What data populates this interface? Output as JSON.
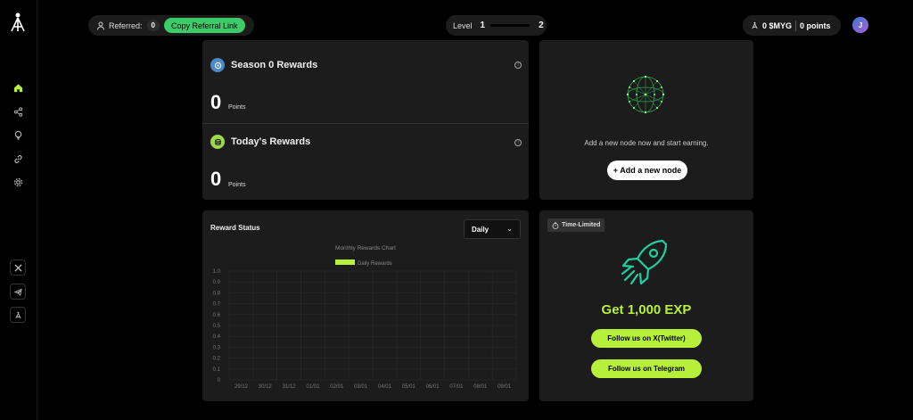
{
  "referral": {
    "label": "Referred:",
    "count": "0",
    "button": "Copy Referral Link"
  },
  "level": {
    "label": "Level",
    "current": "1",
    "next": "2",
    "progress": 0
  },
  "balance": {
    "myg": "0 $MYG",
    "points": "0 points"
  },
  "avatar": {
    "initial": "J"
  },
  "sidebar": {
    "nav": [
      "home-icon",
      "share-icon",
      "bulb-icon",
      "link-icon",
      "gear-icon"
    ],
    "social": [
      "x-icon",
      "telegram-icon",
      "logo-icon"
    ]
  },
  "season": {
    "title": "Season 0 Rewards",
    "value": "0",
    "unit": "Points"
  },
  "today": {
    "title": "Today's Rewards",
    "value": "0",
    "unit": "Points"
  },
  "node": {
    "text": "Add a new node now and start earning.",
    "button": "+ Add a new node"
  },
  "reward_status": {
    "title": "Reward Status",
    "select": "Daily"
  },
  "promo": {
    "badge": "Time-Limited",
    "title": "Get 1,000 EXP",
    "twitter_button": "Follow us on X(Twitter)",
    "telegram_button": "Follow us on Telegram"
  },
  "colors": {
    "accent": "#b6f03a",
    "referral_btn": "#3dcc6a",
    "card": "#1c1c1c"
  },
  "chart_data": {
    "type": "bar",
    "title": "Monthly Rewards Chart",
    "categories": [
      "29/12",
      "30/12",
      "31/12",
      "01/01",
      "02/01",
      "03/01",
      "04/01",
      "05/01",
      "06/01",
      "07/01",
      "08/01",
      "09/01"
    ],
    "series": [
      {
        "name": "Daily Rewards",
        "color": "#b6f03a",
        "values": [
          0,
          0,
          0,
          0,
          0,
          0,
          0,
          0,
          0,
          0,
          0,
          0
        ]
      }
    ],
    "yticks": [
      "0",
      "0.1",
      "0.2",
      "0.3",
      "0.4",
      "0.5",
      "0.6",
      "0.7",
      "0.8",
      "0.9",
      "1.0"
    ],
    "ylim": [
      0,
      1
    ],
    "grid": true,
    "legend": "top-center"
  }
}
